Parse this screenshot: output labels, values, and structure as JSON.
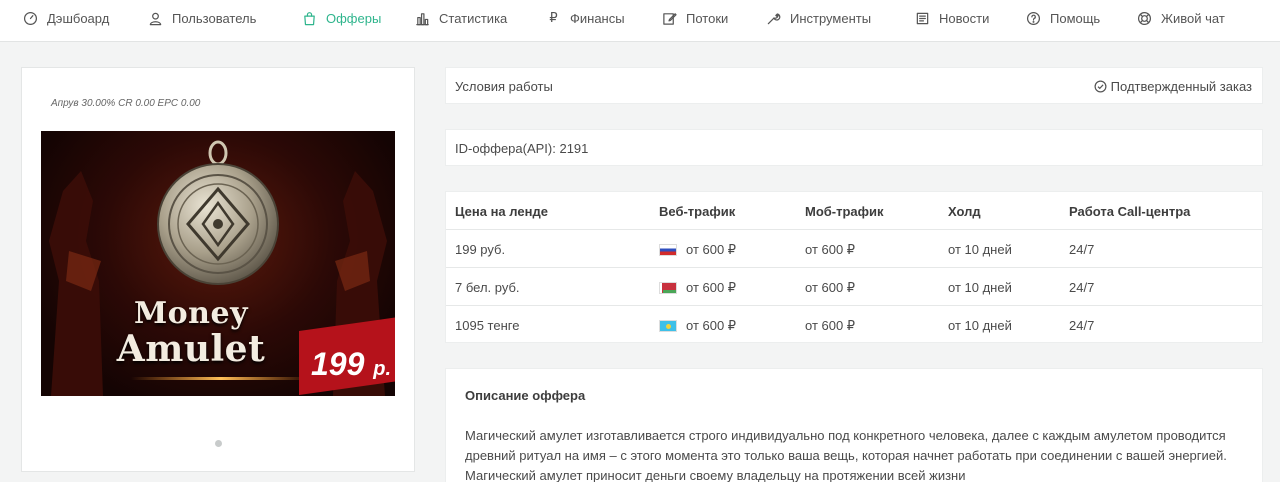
{
  "nav": {
    "items": [
      {
        "label": "Дэшбоард",
        "icon": "gauge-icon"
      },
      {
        "label": "Пользователь",
        "icon": "user-icon"
      },
      {
        "label": "Офферы",
        "icon": "shopping-bag-icon"
      },
      {
        "label": "Статистика",
        "icon": "bar-chart-icon"
      },
      {
        "label": "Финансы",
        "icon": "ruble-icon"
      },
      {
        "label": "Потоки",
        "icon": "edit-icon"
      },
      {
        "label": "Инструменты",
        "icon": "wrench-icon"
      },
      {
        "label": "Новости",
        "icon": "newspaper-icon"
      },
      {
        "label": "Помощь",
        "icon": "question-icon"
      },
      {
        "label": "Живой чат",
        "icon": "chat-icon"
      }
    ],
    "active": "Офферы",
    "active_color": "#2fb58d"
  },
  "offer": {
    "stats": "Апрув 30.00% CR 0.00 EPC 0.00",
    "promo": {
      "title_line1": "Money",
      "title_line2": "Amulet",
      "price": "199",
      "currency": "р."
    }
  },
  "conditions": {
    "label": "Условия работы",
    "confirmed": "Подтвержденный заказ"
  },
  "offer_id": {
    "label": "ID-оффера(API): 2191"
  },
  "prices_table": {
    "headers": [
      "Цена на ленде",
      "Веб-трафик",
      "Моб-трафик",
      "Холд",
      "Работа Call-центра"
    ],
    "rows": [
      {
        "price": "199 руб.",
        "flag": "russia-flag-icon",
        "web": "от 600 ₽",
        "mob": "от 600 ₽",
        "hold": "от 10 дней",
        "call": "24/7"
      },
      {
        "price": "7 бел. руб.",
        "flag": "belarus-flag-icon",
        "web": "от 600 ₽",
        "mob": "от 600 ₽",
        "hold": "от 10 дней",
        "call": "24/7"
      },
      {
        "price": "1095 тенге",
        "flag": "kazakhstan-flag-icon",
        "web": "от 600 ₽",
        "mob": "от 600 ₽",
        "hold": "от 10 дней",
        "call": "24/7"
      }
    ]
  },
  "description": {
    "title": "Описание оффера",
    "text": "Магический амулет изготавливается строго индивидуально под конкретного человека, далее с каждым амулетом проводится древний ритуал на имя – с этого момента это только ваша вещь, которая начнет работать при соединении с вашей энергией. Магический амулет приносит деньги своему владельцу на протяжении всей жизни"
  },
  "colors": {
    "accent": "#2fb58d",
    "price_tag": "#b5121b"
  }
}
